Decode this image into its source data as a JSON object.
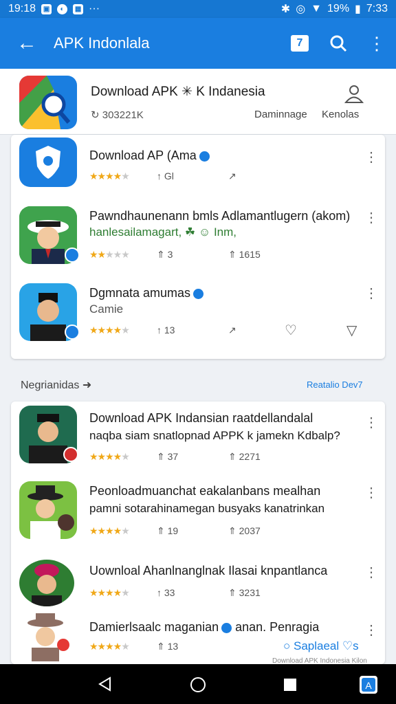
{
  "status": {
    "time_left": "19:18",
    "battery": "19%",
    "time_right": "7:33"
  },
  "appbar": {
    "title": "APK Indonlala"
  },
  "header": {
    "title": "Download APK ✳ K Indanesia",
    "meta": "↻ 303221K",
    "link1": "Daminnage",
    "link2": "Kenolas"
  },
  "card1": [
    {
      "name": "Download AP (Ama",
      "m1": "↑ Gl",
      "m2": "↗"
    },
    {
      "name": "Pawndhaunenann bmls Adlamantlugern (akom)",
      "sub": "hanlesailamagart, ☘ ☺ Inm,",
      "m1": "⇑ 3",
      "m2": "⇑ 1615"
    },
    {
      "name": "Dgmnata amumas",
      "sub": "Camie",
      "m1": "↑ 13",
      "m2": "↗"
    }
  ],
  "section": {
    "title": "Negrianidas",
    "link": "Reatalio Dev7"
  },
  "card2": [
    {
      "name": "Download APK Indansian raatdellandalal",
      "sub": "naqba siam snatlopnad APPK k jamekn Kdbalp?",
      "m1": "⇑ 37",
      "m2": "⇑ 2271"
    },
    {
      "name": "Peonloadmuanchat eakalanbans mealhan",
      "sub": "pamni sotarahinamegan busyaks kanatrinkan",
      "m1": "⇑ 19",
      "m2": "⇑ 2037"
    },
    {
      "name": "Uownloal Ahanlnanglnak Ilasai knpantlanca",
      "m1": "↑ 33",
      "m2": "⇑ 3231"
    },
    {
      "name": "Damierlsaalc maganian",
      "name_tail": "anan. Penragia",
      "m1": "⇑ 13"
    }
  ],
  "bottom": {
    "link": "○ Saplaeal ♡s",
    "faint": "Download APK Indonesia Kilon"
  },
  "colors": {
    "appbar": "#1a7ee0",
    "status": "#1677d2",
    "star": "#f0a818"
  }
}
